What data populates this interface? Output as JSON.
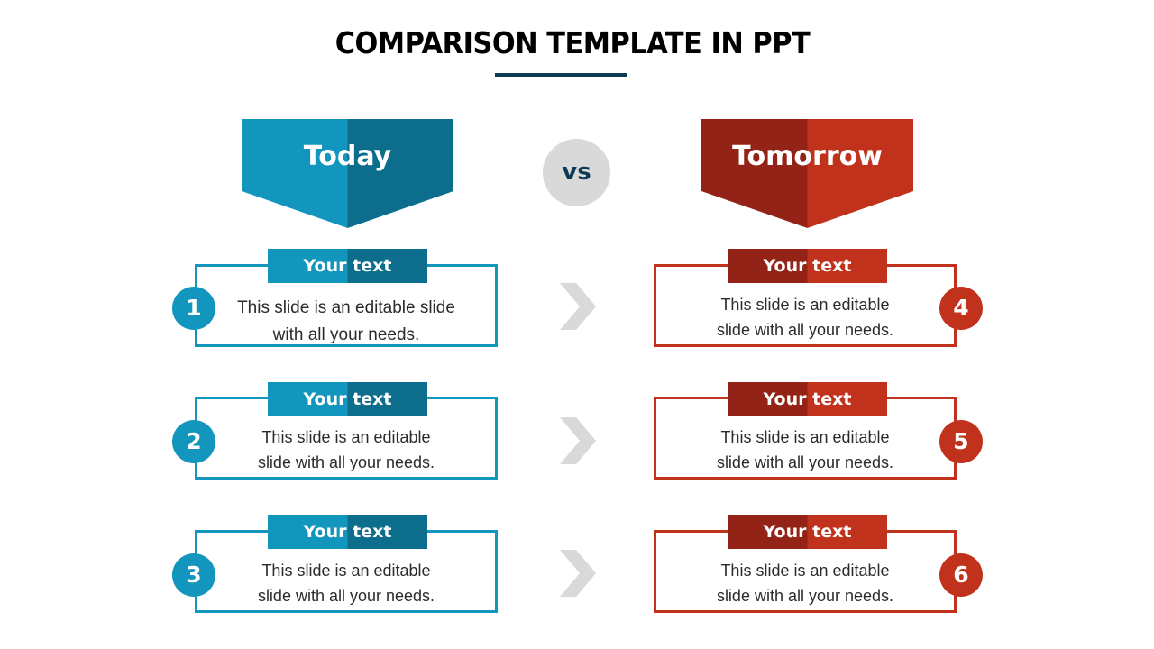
{
  "title": "COMPARISON TEMPLATE IN PPT",
  "colors": {
    "blue": "#1296bd",
    "blue_dark": "#0c6e8c",
    "red": "#c1321c",
    "red_dark": "#922316",
    "navy": "#0e3a52",
    "gray": "#d9d9d9"
  },
  "left": {
    "heading": "Today",
    "items": [
      {
        "number": "1",
        "tag": "Your text",
        "text": "This slide is an editable slide with all your needs."
      },
      {
        "number": "2",
        "tag": "Your text",
        "text": "This slide is an editable slide with all your needs."
      },
      {
        "number": "3",
        "tag": "Your text",
        "text": "This slide is an editable slide with all your needs."
      }
    ]
  },
  "vs_label": "vs",
  "right": {
    "heading": "Tomorrow",
    "items": [
      {
        "number": "4",
        "tag": "Your text",
        "text": "This slide is an editable slide with all your needs."
      },
      {
        "number": "5",
        "tag": "Your text",
        "text": "This slide is an editable slide with all your needs."
      },
      {
        "number": "6",
        "tag": "Your text",
        "text": "This slide is an editable slide with all your needs."
      }
    ]
  },
  "arrow_icon": "chevron-right-icon"
}
